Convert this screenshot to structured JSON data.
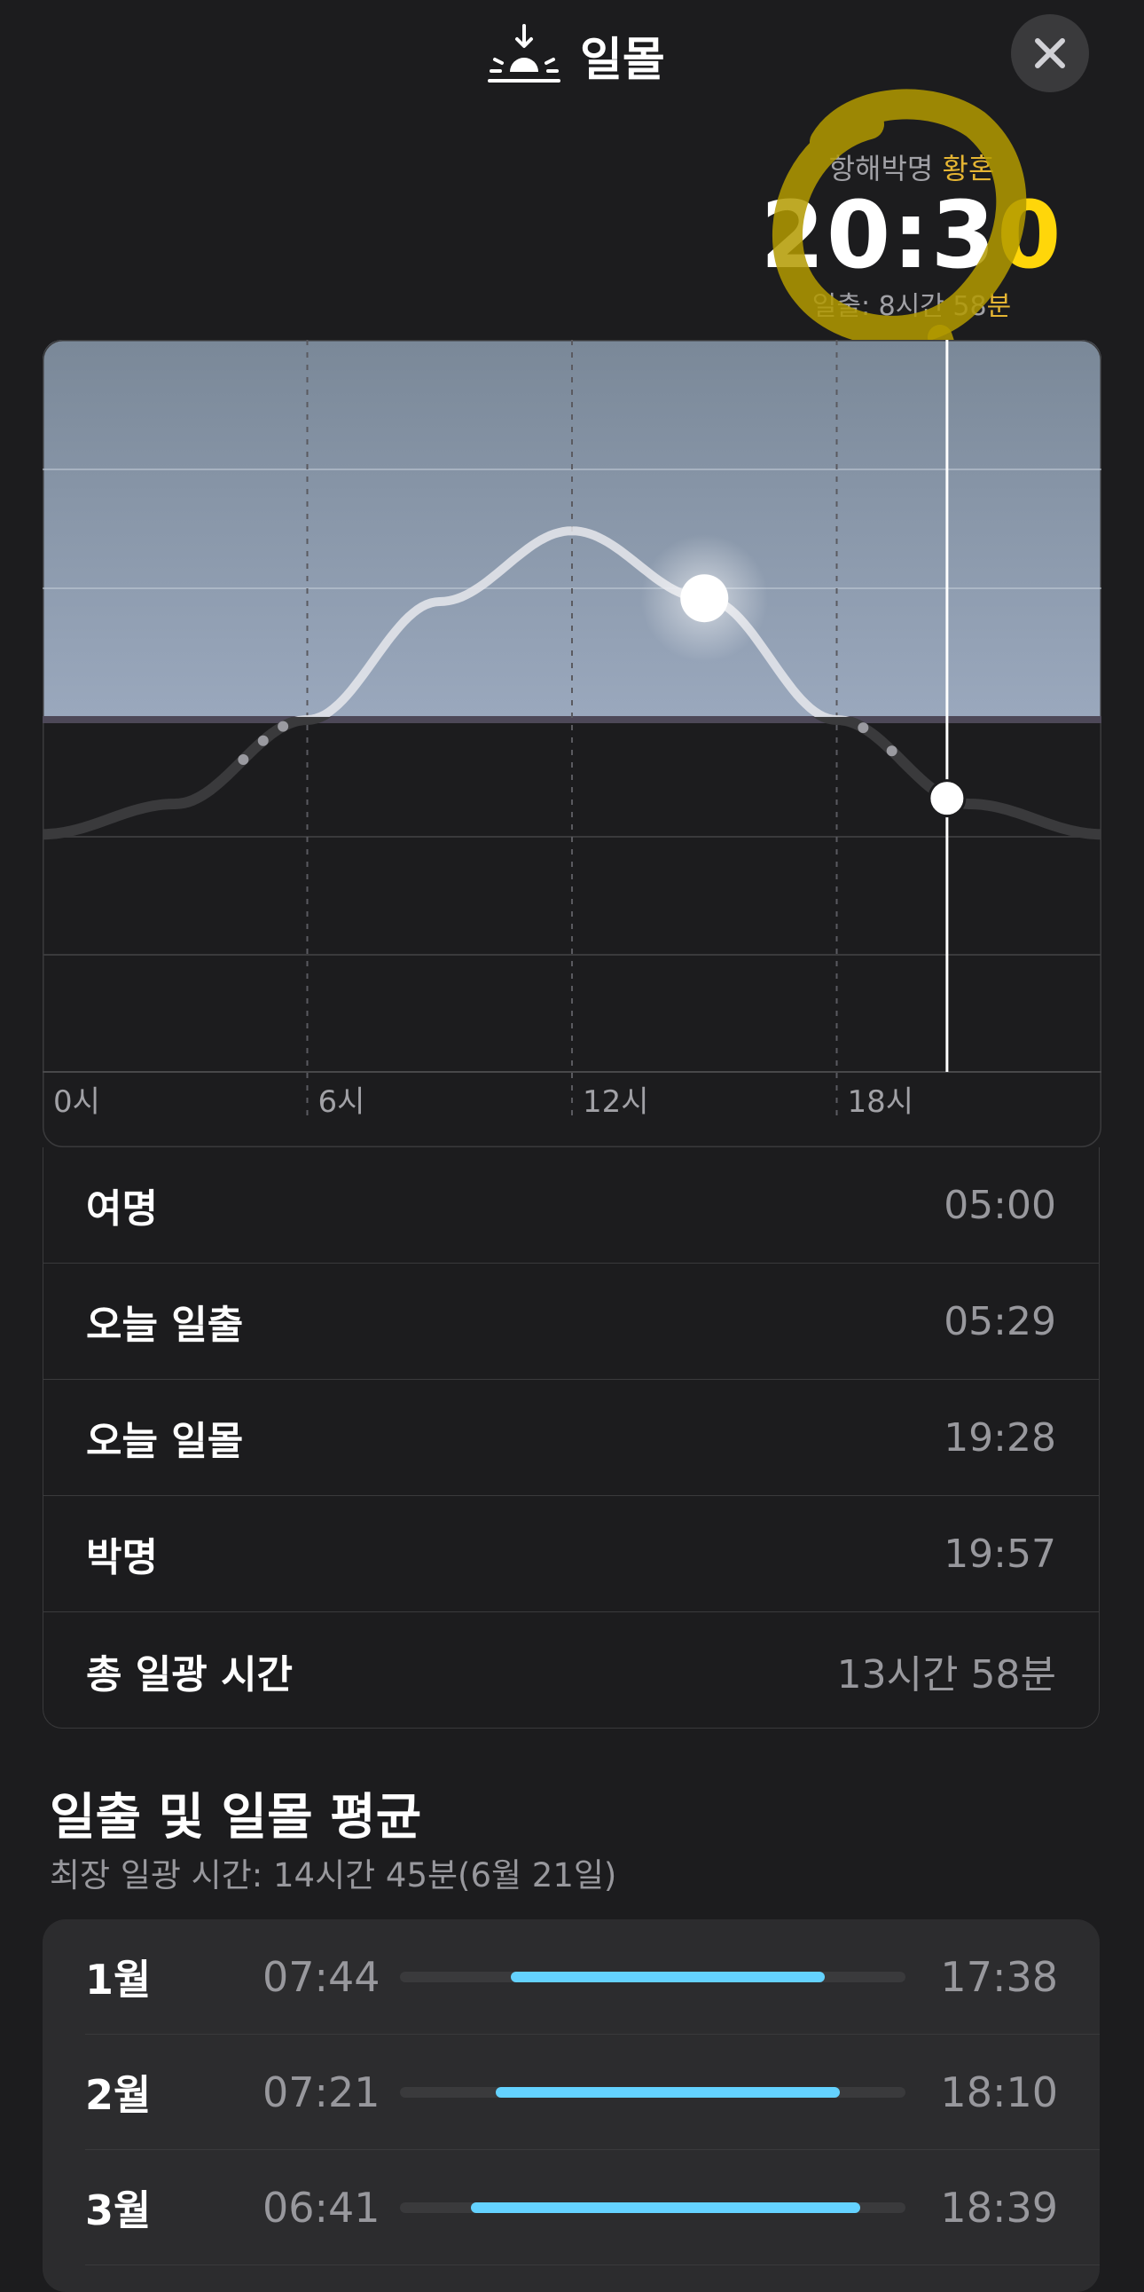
{
  "header": {
    "title": "일몰",
    "icon": "sunset-icon",
    "close_icon": "close-icon"
  },
  "readout": {
    "label_prefix": "항해박명",
    "label_accent": "황혼",
    "time_main": "20:3",
    "time_accent": "0",
    "sub_prefix": "일출: 8시간 58",
    "sub_accent": "분"
  },
  "chart_data": {
    "type": "line",
    "x_ticks": [
      "0시",
      "6시",
      "12시",
      "18시"
    ],
    "xlim": [
      0,
      24
    ],
    "sun_elevation_curve": [
      [
        0,
        -34
      ],
      [
        3,
        -25
      ],
      [
        6,
        0
      ],
      [
        9,
        35
      ],
      [
        12,
        56
      ],
      [
        15,
        36
      ],
      [
        18,
        0
      ],
      [
        21,
        -25
      ],
      [
        24,
        -34
      ]
    ],
    "current_time": 20.5,
    "colors": {
      "sky": "#8a9bb3",
      "night": "#1c1c1e",
      "curve": "#d8dbe0",
      "cursor": "#ffffff"
    }
  },
  "details": [
    {
      "name": "여명",
      "value": "05:00"
    },
    {
      "name": "오늘 일출",
      "value": "05:29"
    },
    {
      "name": "오늘 일몰",
      "value": "19:28"
    },
    {
      "name": "박명",
      "value": "19:57"
    },
    {
      "name": "총 일광 시간",
      "value": "13시간 58분"
    }
  ],
  "averages": {
    "title": "일출 및 일몰 평균",
    "subtitle": "최장 일광 시간: 14시간 45분(6월 21일)",
    "months": [
      {
        "month": "1월",
        "sunrise": "07:44",
        "sunset": "17:38",
        "bar_start": 0.22,
        "bar_end": 0.84
      },
      {
        "month": "2월",
        "sunrise": "07:21",
        "sunset": "18:10",
        "bar_start": 0.19,
        "bar_end": 0.87
      },
      {
        "month": "3월",
        "sunrise": "06:41",
        "sunset": "18:39",
        "bar_start": 0.14,
        "bar_end": 0.91
      }
    ]
  }
}
